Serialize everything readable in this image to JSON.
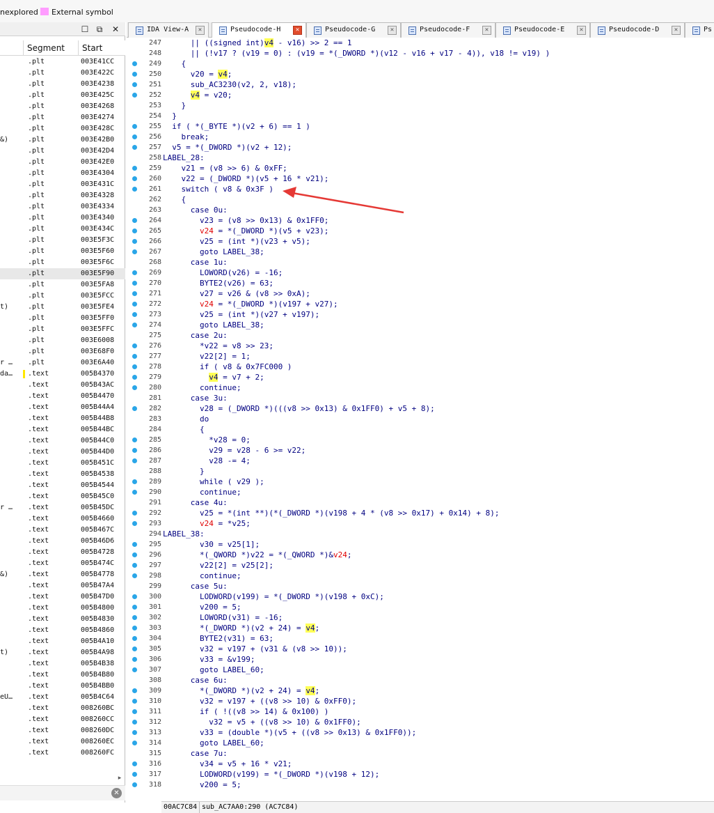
{
  "legend": {
    "unexplored": "nexplored",
    "external": "External symbol",
    "external_color": "#ff9cff"
  },
  "left_panel": {
    "columns": {
      "segment": "Segment",
      "start": "Start"
    },
    "rows": [
      {
        "n": "",
        "seg": ".plt",
        "start": "003E41CC"
      },
      {
        "n": "",
        "seg": ".plt",
        "start": "003E422C"
      },
      {
        "n": "",
        "seg": ".plt",
        "start": "003E4238"
      },
      {
        "n": "",
        "seg": ".plt",
        "start": "003E425C"
      },
      {
        "n": "",
        "seg": ".plt",
        "start": "003E4268"
      },
      {
        "n": "",
        "seg": ".plt",
        "start": "003E4274"
      },
      {
        "n": "",
        "seg": ".plt",
        "start": "003E428C"
      },
      {
        "n": "&)",
        "seg": ".plt",
        "start": "003E42B0"
      },
      {
        "n": "",
        "seg": ".plt",
        "start": "003E42D4"
      },
      {
        "n": "",
        "seg": ".plt",
        "start": "003E42E0"
      },
      {
        "n": "",
        "seg": ".plt",
        "start": "003E4304"
      },
      {
        "n": "",
        "seg": ".plt",
        "start": "003E431C"
      },
      {
        "n": "",
        "seg": ".plt",
        "start": "003E4328"
      },
      {
        "n": "",
        "seg": ".plt",
        "start": "003E4334"
      },
      {
        "n": "",
        "seg": ".plt",
        "start": "003E4340"
      },
      {
        "n": "",
        "seg": ".plt",
        "start": "003E434C"
      },
      {
        "n": "",
        "seg": ".plt",
        "start": "003E5F3C"
      },
      {
        "n": "",
        "seg": ".plt",
        "start": "003E5F60"
      },
      {
        "n": "",
        "seg": ".plt",
        "start": "003E5F6C"
      },
      {
        "n": "",
        "seg": ".plt",
        "start": "003E5F90",
        "sel": true
      },
      {
        "n": "",
        "seg": ".plt",
        "start": "003E5FA8"
      },
      {
        "n": "",
        "seg": ".plt",
        "start": "003E5FCC"
      },
      {
        "n": "t)",
        "seg": ".plt",
        "start": "003E5FE4"
      },
      {
        "n": "",
        "seg": ".plt",
        "start": "003E5FF0"
      },
      {
        "n": "",
        "seg": ".plt",
        "start": "003E5FFC"
      },
      {
        "n": "",
        "seg": ".plt",
        "start": "003E6008"
      },
      {
        "n": "",
        "seg": ".plt",
        "start": "003E68F0"
      },
      {
        "n": "r …",
        "seg": ".plt",
        "start": "003E6A40"
      },
      {
        "n": "da…",
        "seg": ".text",
        "start": "005B4370",
        "mark": true
      },
      {
        "n": "",
        "seg": ".text",
        "start": "005B43AC"
      },
      {
        "n": "",
        "seg": ".text",
        "start": "005B4470"
      },
      {
        "n": "",
        "seg": ".text",
        "start": "005B44A4"
      },
      {
        "n": "",
        "seg": ".text",
        "start": "005B44B8"
      },
      {
        "n": "",
        "seg": ".text",
        "start": "005B44BC"
      },
      {
        "n": "",
        "seg": ".text",
        "start": "005B44C0"
      },
      {
        "n": "",
        "seg": ".text",
        "start": "005B44D0"
      },
      {
        "n": "",
        "seg": ".text",
        "start": "005B451C"
      },
      {
        "n": "",
        "seg": ".text",
        "start": "005B4538"
      },
      {
        "n": "",
        "seg": ".text",
        "start": "005B4544"
      },
      {
        "n": "",
        "seg": ".text",
        "start": "005B45C0"
      },
      {
        "n": "r …",
        "seg": ".text",
        "start": "005B45DC"
      },
      {
        "n": "",
        "seg": ".text",
        "start": "005B4660"
      },
      {
        "n": "",
        "seg": ".text",
        "start": "005B467C"
      },
      {
        "n": "",
        "seg": ".text",
        "start": "005B46D6"
      },
      {
        "n": "",
        "seg": ".text",
        "start": "005B4728"
      },
      {
        "n": "",
        "seg": ".text",
        "start": "005B474C"
      },
      {
        "n": "&)",
        "seg": ".text",
        "start": "005B4778"
      },
      {
        "n": "",
        "seg": ".text",
        "start": "005B47A4"
      },
      {
        "n": "",
        "seg": ".text",
        "start": "005B47D0"
      },
      {
        "n": "",
        "seg": ".text",
        "start": "005B4800"
      },
      {
        "n": "",
        "seg": ".text",
        "start": "005B4830"
      },
      {
        "n": "",
        "seg": ".text",
        "start": "005B4860"
      },
      {
        "n": "",
        "seg": ".text",
        "start": "005B4A10"
      },
      {
        "n": "t)",
        "seg": ".text",
        "start": "005B4A98"
      },
      {
        "n": "",
        "seg": ".text",
        "start": "005B4B38"
      },
      {
        "n": "",
        "seg": ".text",
        "start": "005B4B80"
      },
      {
        "n": "",
        "seg": ".text",
        "start": "005B4BB0"
      },
      {
        "n": "eU…",
        "seg": ".text",
        "start": "005B4C64"
      },
      {
        "n": "",
        "seg": ".text",
        "start": "008260BC"
      },
      {
        "n": "",
        "seg": ".text",
        "start": "008260CC"
      },
      {
        "n": "",
        "seg": ".text",
        "start": "008260DC"
      },
      {
        "n": "",
        "seg": ".text",
        "start": "008260EC"
      },
      {
        "n": "",
        "seg": ".text",
        "start": "008260FC"
      }
    ]
  },
  "tabs": [
    {
      "label": "IDA View-A",
      "active": false
    },
    {
      "label": "Pseudocode-H",
      "active": true
    },
    {
      "label": "Pseudocode-G",
      "active": false
    },
    {
      "label": "Pseudocode-F",
      "active": false
    },
    {
      "label": "Pseudocode-E",
      "active": false
    },
    {
      "label": "Pseudocode-D",
      "active": false
    },
    {
      "label": "Ps",
      "active": false
    }
  ],
  "code_lines": [
    {
      "ln": "247",
      "dot": false,
      "t": "      || ((signed int)v4 - v16) >> 2 == 1"
    },
    {
      "ln": "248",
      "dot": false,
      "t": "      || (!v17 ? (v19 = 0) : (v19 = *(_DWORD *)(v12 - v16 + v17 - 4)), v18 != v19) )"
    },
    {
      "ln": "249",
      "dot": true,
      "t": "    {"
    },
    {
      "ln": "250",
      "dot": true,
      "t": "      v20 = v4;"
    },
    {
      "ln": "251",
      "dot": true,
      "t": "      sub_AC3230(v2, 2, v18);"
    },
    {
      "ln": "252",
      "dot": true,
      "t": "      v4 = v20;"
    },
    {
      "ln": "253",
      "dot": false,
      "t": "    }"
    },
    {
      "ln": "254",
      "dot": false,
      "t": "  }"
    },
    {
      "ln": "255",
      "dot": true,
      "t": "  if ( *(_BYTE *)(v2 + 6) == 1 )"
    },
    {
      "ln": "256",
      "dot": true,
      "t": "    break;"
    },
    {
      "ln": "257",
      "dot": true,
      "t": "  v5 = *(_DWORD *)(v2 + 12);"
    },
    {
      "ln": "258",
      "dot": false,
      "t": "LABEL_28:"
    },
    {
      "ln": "259",
      "dot": true,
      "t": "    v21 = (v8 >> 6) & 0xFF;"
    },
    {
      "ln": "260",
      "dot": true,
      "t": "    v22 = (_DWORD *)(v5 + 16 * v21);"
    },
    {
      "ln": "261",
      "dot": true,
      "t": "    switch ( v8 & 0x3F )"
    },
    {
      "ln": "262",
      "dot": false,
      "t": "    {"
    },
    {
      "ln": "263",
      "dot": false,
      "t": "      case 0u:"
    },
    {
      "ln": "264",
      "dot": true,
      "t": "        v23 = (v8 >> 0x13) & 0x1FF0;"
    },
    {
      "ln": "265",
      "dot": true,
      "t": "        v24 = *(_DWORD *)(v5 + v23);"
    },
    {
      "ln": "266",
      "dot": true,
      "t": "        v25 = (int *)(v23 + v5);"
    },
    {
      "ln": "267",
      "dot": true,
      "t": "        goto LABEL_38;"
    },
    {
      "ln": "268",
      "dot": false,
      "t": "      case 1u:"
    },
    {
      "ln": "269",
      "dot": true,
      "t": "        LOWORD(v26) = -16;"
    },
    {
      "ln": "270",
      "dot": true,
      "t": "        BYTE2(v26) = 63;"
    },
    {
      "ln": "271",
      "dot": true,
      "t": "        v27 = v26 & (v8 >> 0xA);"
    },
    {
      "ln": "272",
      "dot": true,
      "t": "        v24 = *(_DWORD *)(v197 + v27);"
    },
    {
      "ln": "273",
      "dot": true,
      "t": "        v25 = (int *)(v27 + v197);"
    },
    {
      "ln": "274",
      "dot": true,
      "t": "        goto LABEL_38;"
    },
    {
      "ln": "275",
      "dot": false,
      "t": "      case 2u:"
    },
    {
      "ln": "276",
      "dot": true,
      "t": "        *v22 = v8 >> 23;"
    },
    {
      "ln": "277",
      "dot": true,
      "t": "        v22[2] = 1;"
    },
    {
      "ln": "278",
      "dot": true,
      "t": "        if ( v8 & 0x7FC000 )"
    },
    {
      "ln": "279",
      "dot": true,
      "t": "          v4 = v7 + 2;"
    },
    {
      "ln": "280",
      "dot": true,
      "t": "        continue;"
    },
    {
      "ln": "281",
      "dot": false,
      "t": "      case 3u:"
    },
    {
      "ln": "282",
      "dot": true,
      "t": "        v28 = (_DWORD *)(((v8 >> 0x13) & 0x1FF0) + v5 + 8);"
    },
    {
      "ln": "283",
      "dot": false,
      "t": "        do"
    },
    {
      "ln": "284",
      "dot": false,
      "t": "        {"
    },
    {
      "ln": "285",
      "dot": true,
      "t": "          *v28 = 0;"
    },
    {
      "ln": "286",
      "dot": true,
      "t": "          v29 = v28 - 6 >= v22;"
    },
    {
      "ln": "287",
      "dot": true,
      "t": "          v28 -= 4;"
    },
    {
      "ln": "288",
      "dot": false,
      "t": "        }"
    },
    {
      "ln": "289",
      "dot": true,
      "t": "        while ( v29 );"
    },
    {
      "ln": "290",
      "dot": true,
      "t": "        continue;"
    },
    {
      "ln": "291",
      "dot": false,
      "t": "      case 4u:"
    },
    {
      "ln": "292",
      "dot": true,
      "t": "        v25 = *(int **)(*(_DWORD *)(v198 + 4 * (v8 >> 0x17) + 0x14) + 8);"
    },
    {
      "ln": "293",
      "dot": true,
      "t": "        v24 = *v25;"
    },
    {
      "ln": "294",
      "dot": false,
      "t": "LABEL_38:"
    },
    {
      "ln": "295",
      "dot": true,
      "t": "        v30 = v25[1];"
    },
    {
      "ln": "296",
      "dot": true,
      "t": "        *(_QWORD *)v22 = *(_QWORD *)&v24;"
    },
    {
      "ln": "297",
      "dot": true,
      "t": "        v22[2] = v25[2];"
    },
    {
      "ln": "298",
      "dot": true,
      "t": "        continue;"
    },
    {
      "ln": "299",
      "dot": false,
      "t": "      case 5u:"
    },
    {
      "ln": "300",
      "dot": true,
      "t": "        LODWORD(v199) = *(_DWORD *)(v198 + 0xC);"
    },
    {
      "ln": "301",
      "dot": true,
      "t": "        v200 = 5;"
    },
    {
      "ln": "302",
      "dot": true,
      "t": "        LOWORD(v31) = -16;"
    },
    {
      "ln": "303",
      "dot": true,
      "t": "        *(_DWORD *)(v2 + 24) = v4;"
    },
    {
      "ln": "304",
      "dot": true,
      "t": "        BYTE2(v31) = 63;"
    },
    {
      "ln": "305",
      "dot": true,
      "t": "        v32 = v197 + (v31 & (v8 >> 10));"
    },
    {
      "ln": "306",
      "dot": true,
      "t": "        v33 = &v199;"
    },
    {
      "ln": "307",
      "dot": true,
      "t": "        goto LABEL_60;"
    },
    {
      "ln": "308",
      "dot": false,
      "t": "      case 6u:"
    },
    {
      "ln": "309",
      "dot": true,
      "t": "        *(_DWORD *)(v2 + 24) = v4;"
    },
    {
      "ln": "310",
      "dot": true,
      "t": "        v32 = v197 + ((v8 >> 10) & 0xFF0);"
    },
    {
      "ln": "311",
      "dot": true,
      "t": "        if ( !((v8 >> 14) & 0x100) )"
    },
    {
      "ln": "312",
      "dot": true,
      "t": "          v32 = v5 + ((v8 >> 10) & 0x1FF0);"
    },
    {
      "ln": "313",
      "dot": true,
      "t": "        v33 = (double *)(v5 + ((v8 >> 0x13) & 0x1FF0));"
    },
    {
      "ln": "314",
      "dot": true,
      "t": "        goto LABEL_60;"
    },
    {
      "ln": "315",
      "dot": false,
      "t": "      case 7u:"
    },
    {
      "ln": "316",
      "dot": true,
      "t": "        v34 = v5 + 16 * v21;"
    },
    {
      "ln": "317",
      "dot": true,
      "t": "        LODWORD(v199) = *(_DWORD *)(v198 + 12);"
    },
    {
      "ln": "318",
      "dot": true,
      "t": "        v200 = 5;"
    }
  ],
  "colors": {
    "highlight": "#ffff55",
    "var_red": "#e00000",
    "dot": "#2aa6e8",
    "code": "#000080",
    "arrow": "#e53935"
  },
  "status": {
    "addr": "00AC7C84",
    "func": "sub_AC7AA0:290 (AC7C84)"
  }
}
